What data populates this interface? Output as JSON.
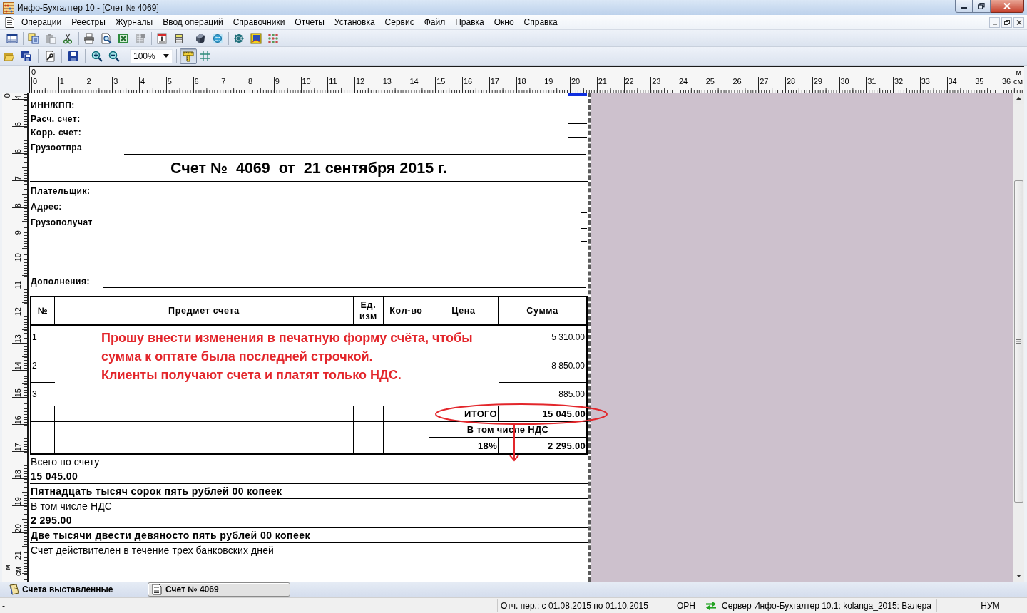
{
  "window": {
    "title": "Инфо-Бухгалтер 10 - [Счет № 4069]"
  },
  "menu": {
    "items": [
      "Операции",
      "Реестры",
      "Журналы",
      "Ввод операций",
      "Справочники",
      "Отчеты",
      "Установка",
      "Сервис",
      "Файл",
      "Правка",
      "Окно",
      "Справка"
    ]
  },
  "toolbar_1": {
    "groups": [
      [
        {
          "kind": "table",
          "disabled": false
        }
      ],
      [
        {
          "kind": "copy",
          "disabled": false
        },
        {
          "kind": "paste",
          "disabled": true
        },
        {
          "kind": "cut",
          "disabled": false
        }
      ],
      [
        {
          "kind": "print",
          "disabled": false
        },
        {
          "kind": "preview",
          "disabled": false
        },
        {
          "kind": "sheet",
          "disabled": false
        },
        {
          "kind": "export",
          "disabled": true
        }
      ],
      [
        {
          "kind": "calendar",
          "disabled": false
        },
        {
          "kind": "calculator",
          "disabled": false
        }
      ],
      [
        {
          "kind": "cube",
          "disabled": false
        },
        {
          "kind": "globe",
          "disabled": false
        }
      ],
      [
        {
          "kind": "wheel",
          "disabled": false
        },
        {
          "kind": "picture",
          "disabled": false
        },
        {
          "kind": "dots",
          "disabled": false
        }
      ]
    ]
  },
  "toolbar_2": {
    "groups": [
      [
        {
          "kind": "open",
          "pressed": false
        },
        {
          "kind": "save_all",
          "pressed": false
        }
      ],
      [
        {
          "kind": "tool",
          "pressed": false
        }
      ],
      [
        {
          "kind": "save",
          "pressed": false
        }
      ],
      [
        {
          "kind": "zoom_in",
          "pressed": false
        },
        {
          "kind": "zoom_out",
          "pressed": false
        }
      ],
      [
        {
          "kind": "zoom_select",
          "value": "100%"
        }
      ],
      [
        {
          "kind": "ruler",
          "pressed": true
        },
        {
          "kind": "grid",
          "pressed": false
        }
      ]
    ]
  },
  "rulers": {
    "horizontal": {
      "meter_label": "0",
      "meter_unit": "м",
      "labels": [
        "0",
        "1",
        "2",
        "3",
        "4",
        "5",
        "6",
        "7",
        "8",
        "9",
        "10",
        "11",
        "12",
        "13",
        "14",
        "15",
        "16",
        "17",
        "18",
        "19",
        "20",
        "21",
        "22",
        "23",
        "24",
        "25",
        "26",
        "27",
        "28",
        "29",
        "30",
        "31",
        "32",
        "33",
        "34",
        "35",
        "36"
      ],
      "unit": "см"
    },
    "vertical": {
      "meter_label": "0",
      "meter_unit": "м",
      "labels": [
        "4",
        "5",
        "6",
        "7",
        "8",
        "9",
        "10",
        "11",
        "12",
        "13",
        "14",
        "15",
        "16",
        "17",
        "18",
        "19",
        "20",
        "21"
      ],
      "unit": "см"
    }
  },
  "document": {
    "header_fields": [
      "ИНН/КПП:",
      "Расч. счет:",
      "Корр. счет:",
      "Грузоотпра"
    ],
    "title": "Счет №  4069  от  21 сентября 2015 г.",
    "payer_fields": [
      "Плательщик:",
      "Адрес:",
      "Грузополучат"
    ],
    "additions_label": "Дополнения:",
    "table": {
      "columns": [
        "№",
        "Предмет счета",
        "Ед. изм",
        "Кол-во",
        "Цена",
        "Сумма"
      ],
      "rows": [
        {
          "number": "1",
          "amount": "5 310.00"
        },
        {
          "number": "2",
          "amount": "8 850.00"
        },
        {
          "number": "3",
          "amount": "885.00"
        }
      ],
      "total_label": "ИТОГО",
      "total": "15 045.00",
      "vat_caption": "В том числе НДС",
      "vat_rate": "18%",
      "vat_amount": "2 295.00"
    },
    "summary": [
      {
        "kind": "caption",
        "text": "Всего по счету"
      },
      {
        "kind": "amount",
        "text": "15 045.00"
      },
      {
        "kind": "words",
        "text": "Пятнадцать тысяч сорок пять рублей 00 копеек"
      },
      {
        "kind": "caption",
        "text": "В том числе НДС"
      },
      {
        "kind": "amount",
        "text": "2 295.00"
      },
      {
        "kind": "words",
        "text": "Две тысячи двести девяносто пять рублей 00 копеек"
      },
      {
        "kind": "caption",
        "text": "Счет действителен в течение трех банковских дней"
      }
    ]
  },
  "annotation": {
    "lines": [
      "Прошу внести изменения в печатную форму счёта, чтобы",
      "сумма к оптате была последней строчкой.",
      "Клиенты получают счета и платят только НДС."
    ]
  },
  "tabs": [
    {
      "label": "Счета выставленные",
      "kind": "book",
      "selected": false
    },
    {
      "label": "Счет № 4069",
      "kind": "document",
      "selected": true
    }
  ],
  "status_bar": {
    "items": [
      {
        "kind": "text",
        "text": "-"
      },
      {
        "kind": "text",
        "text": "Отч. пер.: с 01.08.2015 по 01.10.2015"
      },
      {
        "kind": "text",
        "text": "ОРН"
      },
      {
        "kind": "connection",
        "text": "Сервер Инфо-Бухгалтер 10.1: kolanga_2015: Валера"
      },
      {
        "kind": "text",
        "text": "НУМ"
      }
    ]
  }
}
